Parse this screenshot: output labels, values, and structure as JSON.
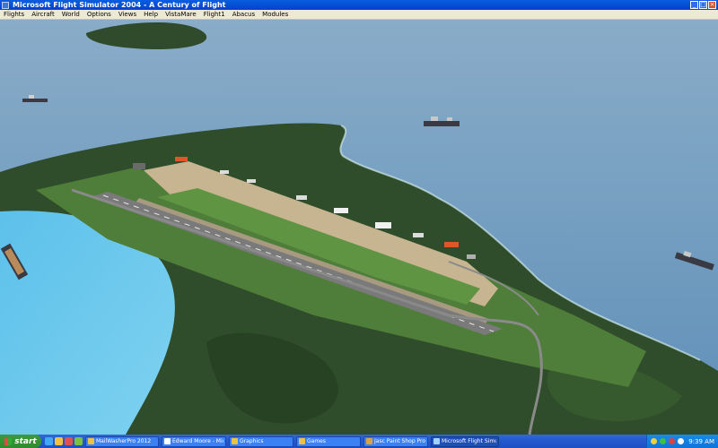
{
  "window": {
    "title": "Microsoft Flight Simulator 2004 - A Century of Flight",
    "buttons": {
      "minimize": "_",
      "maximize": "□",
      "close": "×"
    }
  },
  "menu": [
    "Flights",
    "Aircraft",
    "World",
    "Options",
    "Views",
    "Help",
    "VistaMare",
    "Flight1",
    "Abacus",
    "Modules"
  ],
  "scene": {
    "description_icon": "aerial-island-airport-view",
    "colors": {
      "sea": "#6f9bc0",
      "shallow": "#69c4e8",
      "forest": "#2f4d2a",
      "grass": "#4f7d3a",
      "runway": "#7a7a7a",
      "apron": "#c7b491"
    }
  },
  "taskbar": {
    "start_label": "start",
    "tasks": [
      {
        "label": "MailWasherPro 2012",
        "icon": "mail-icon"
      },
      {
        "label": "Edward Moore - Micro...",
        "icon": "word-icon"
      },
      {
        "label": "Graphics",
        "icon": "folder-icon"
      },
      {
        "label": "Games",
        "icon": "folder-icon"
      },
      {
        "label": "Jasc Paint Shop Pro -...",
        "icon": "paint-icon"
      },
      {
        "label": "Microsoft Flight Simul...",
        "icon": "flightsim-icon"
      }
    ],
    "clock": "9:39 AM"
  }
}
